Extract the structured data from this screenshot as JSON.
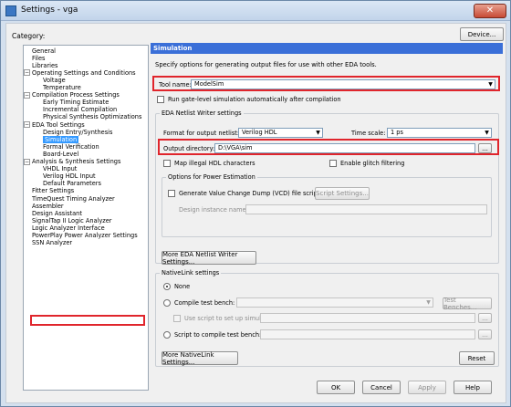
{
  "window": {
    "title": "Settings - vga",
    "close_glyph": "✕"
  },
  "category_label": "Category:",
  "device_button": "Device...",
  "tree": [
    {
      "label": "General",
      "indent": 0
    },
    {
      "label": "Files",
      "indent": 0
    },
    {
      "label": "Libraries",
      "indent": 0
    },
    {
      "label": "Operating Settings and Conditions",
      "indent": 0,
      "expander": "−"
    },
    {
      "label": "Voltage",
      "indent": 1
    },
    {
      "label": "Temperature",
      "indent": 1
    },
    {
      "label": "Compilation Process Settings",
      "indent": 0,
      "expander": "−"
    },
    {
      "label": "Early Timing Estimate",
      "indent": 1
    },
    {
      "label": "Incremental Compilation",
      "indent": 1
    },
    {
      "label": "Physical Synthesis Optimizations",
      "indent": 1
    },
    {
      "label": "EDA Tool Settings",
      "indent": 0,
      "expander": "−"
    },
    {
      "label": "Design Entry/Synthesis",
      "indent": 1
    },
    {
      "label": "Simulation",
      "indent": 1,
      "selected": true
    },
    {
      "label": "Formal Verification",
      "indent": 1
    },
    {
      "label": "Board-Level",
      "indent": 1
    },
    {
      "label": "Analysis & Synthesis Settings",
      "indent": 0,
      "expander": "−"
    },
    {
      "label": "VHDL Input",
      "indent": 1
    },
    {
      "label": "Verilog HDL Input",
      "indent": 1
    },
    {
      "label": "Default Parameters",
      "indent": 1
    },
    {
      "label": "Fitter Settings",
      "indent": 0
    },
    {
      "label": "TimeQuest Timing Analyzer",
      "indent": 0
    },
    {
      "label": "Assembler",
      "indent": 0
    },
    {
      "label": "Design Assistant",
      "indent": 0
    },
    {
      "label": "SignalTap II Logic Analyzer",
      "indent": 0
    },
    {
      "label": "Logic Analyzer Interface",
      "indent": 0
    },
    {
      "label": "PowerPlay Power Analyzer Settings",
      "indent": 0
    },
    {
      "label": "SSN Analyzer",
      "indent": 0
    }
  ],
  "content": {
    "header": "Simulation",
    "description": "Specify options for generating output files for use with other EDA tools.",
    "tool_name_label": "Tool name:",
    "tool_name_value": "ModelSim",
    "run_gate_level": "Run gate-level simulation automatically after compilation",
    "eda_group": "EDA Netlist Writer settings",
    "format_label": "Format for output netlist:",
    "format_value": "Verilog HDL",
    "time_scale_label": "Time scale:",
    "time_scale_value": "1 ps",
    "output_dir_label": "Output directory:",
    "output_dir_value": "D:\\VGA\\sim",
    "browse": "...",
    "map_illegal": "Map illegal HDL characters",
    "enable_glitch": "Enable glitch filtering",
    "power_group": "Options for Power Estimation",
    "generate_vcd": "Generate Value Change Dump (VCD) file script",
    "script_settings": "Script Settings...",
    "design_instance_label": "Design instance name:",
    "more_eda": "More EDA Netlist Writer Settings...",
    "nativelink_group": "NativeLink settings",
    "none_label": "None",
    "compile_tb_label": "Compile test bench:",
    "test_benches": "Test Benches...",
    "use_script_label": "Use script to set up simulation:",
    "script_compile_label": "Script to compile test bench:",
    "more_nativelink": "More NativeLink Settings...",
    "reset": "Reset"
  },
  "footer": {
    "ok": "OK",
    "cancel": "Cancel",
    "apply": "Apply",
    "help": "Help"
  },
  "colors": {
    "accent": "#3a6fd8",
    "highlight": "#e0252c",
    "selection": "#3399ff"
  }
}
